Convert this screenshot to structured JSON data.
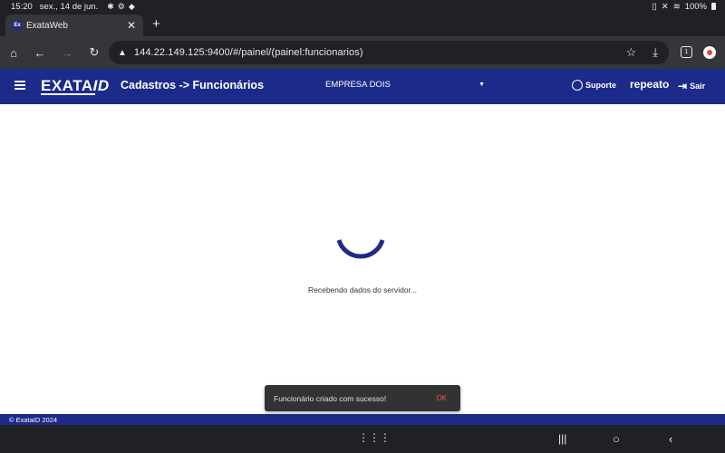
{
  "status_bar": {
    "time": "15:20",
    "date": "sex., 14 de jun.",
    "battery": "100%"
  },
  "browser": {
    "tab_title": "ExataWeb",
    "favicon_text": "Ex",
    "url": "144.22.149.125:9400/#/painel/(painel:funcionarios)",
    "tab_count": "1"
  },
  "header": {
    "logo_main": "EXATA",
    "logo_suffix": "ID",
    "page_title": "Cadastros -> Funcionários",
    "company": "EMPRESA DOIS",
    "support_label": "Suporte",
    "username": "repeato",
    "logout_label": "Sair"
  },
  "content": {
    "loading_text": "Recebendo dados do servidor..."
  },
  "snackbar": {
    "message": "Funcionário criado com sucesso!",
    "action": "OK"
  },
  "footer": {
    "copyright": "© ExataID 2024"
  },
  "colors": {
    "brand_navy": "#1c2a8a",
    "snackbar_action": "#ff4e44"
  }
}
